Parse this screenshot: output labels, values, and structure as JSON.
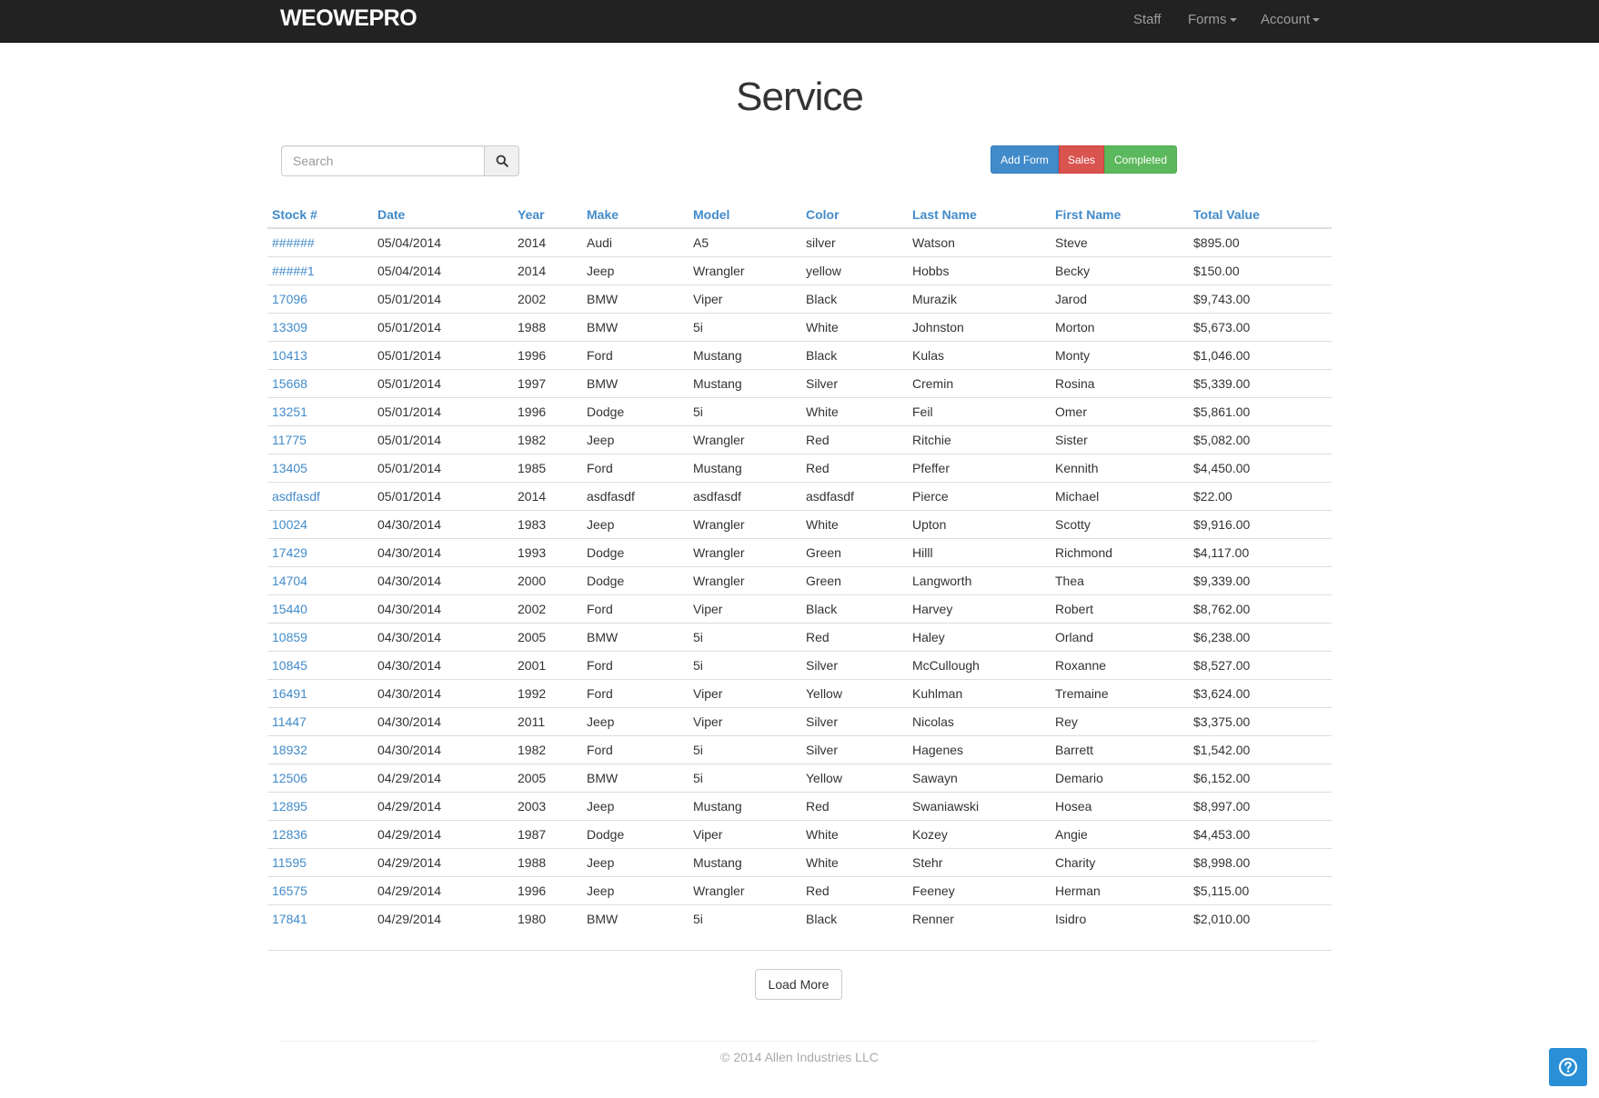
{
  "nav": {
    "brand": "WEOWEPRO",
    "links": [
      {
        "label": "Staff"
      },
      {
        "label": "Forms"
      },
      {
        "label": "Account"
      }
    ]
  },
  "page": {
    "title": "Service"
  },
  "search": {
    "placeholder": "Search",
    "value": ""
  },
  "actions": {
    "add_form": "Add Form",
    "sales": "Sales",
    "completed": "Completed"
  },
  "table": {
    "headers": [
      "Stock #",
      "Date",
      "Year",
      "Make",
      "Model",
      "Color",
      "Last Name",
      "First Name",
      "Total Value"
    ],
    "rows": [
      {
        "stock": "######",
        "date": "05/04/2014",
        "year": "2014",
        "make": "Audi",
        "model": "A5",
        "color": "silver",
        "last": "Watson",
        "first": "Steve",
        "total": "$895.00"
      },
      {
        "stock": "#####1",
        "date": "05/04/2014",
        "year": "2014",
        "make": "Jeep",
        "model": "Wrangler",
        "color": "yellow",
        "last": "Hobbs",
        "first": "Becky",
        "total": "$150.00"
      },
      {
        "stock": "17096",
        "date": "05/01/2014",
        "year": "2002",
        "make": "BMW",
        "model": "Viper",
        "color": "Black",
        "last": "Murazik",
        "first": "Jarod",
        "total": "$9,743.00"
      },
      {
        "stock": "13309",
        "date": "05/01/2014",
        "year": "1988",
        "make": "BMW",
        "model": "5i",
        "color": "White",
        "last": "Johnston",
        "first": "Morton",
        "total": "$5,673.00"
      },
      {
        "stock": "10413",
        "date": "05/01/2014",
        "year": "1996",
        "make": "Ford",
        "model": "Mustang",
        "color": "Black",
        "last": "Kulas",
        "first": "Monty",
        "total": "$1,046.00"
      },
      {
        "stock": "15668",
        "date": "05/01/2014",
        "year": "1997",
        "make": "BMW",
        "model": "Mustang",
        "color": "Silver",
        "last": "Cremin",
        "first": "Rosina",
        "total": "$5,339.00"
      },
      {
        "stock": "13251",
        "date": "05/01/2014",
        "year": "1996",
        "make": "Dodge",
        "model": "5i",
        "color": "White",
        "last": "Feil",
        "first": "Omer",
        "total": "$5,861.00"
      },
      {
        "stock": "11775",
        "date": "05/01/2014",
        "year": "1982",
        "make": "Jeep",
        "model": "Wrangler",
        "color": "Red",
        "last": "Ritchie",
        "first": "Sister",
        "total": "$5,082.00"
      },
      {
        "stock": "13405",
        "date": "05/01/2014",
        "year": "1985",
        "make": "Ford",
        "model": "Mustang",
        "color": "Red",
        "last": "Pfeffer",
        "first": "Kennith",
        "total": "$4,450.00"
      },
      {
        "stock": "asdfasdf",
        "date": "05/01/2014",
        "year": "2014",
        "make": "asdfasdf",
        "model": "asdfasdf",
        "color": "asdfasdf",
        "last": "Pierce",
        "first": "Michael",
        "total": "$22.00"
      },
      {
        "stock": "10024",
        "date": "04/30/2014",
        "year": "1983",
        "make": "Jeep",
        "model": "Wrangler",
        "color": "White",
        "last": "Upton",
        "first": "Scotty",
        "total": "$9,916.00"
      },
      {
        "stock": "17429",
        "date": "04/30/2014",
        "year": "1993",
        "make": "Dodge",
        "model": "Wrangler",
        "color": "Green",
        "last": "Hilll",
        "first": "Richmond",
        "total": "$4,117.00"
      },
      {
        "stock": "14704",
        "date": "04/30/2014",
        "year": "2000",
        "make": "Dodge",
        "model": "Wrangler",
        "color": "Green",
        "last": "Langworth",
        "first": "Thea",
        "total": "$9,339.00"
      },
      {
        "stock": "15440",
        "date": "04/30/2014",
        "year": "2002",
        "make": "Ford",
        "model": "Viper",
        "color": "Black",
        "last": "Harvey",
        "first": "Robert",
        "total": "$8,762.00"
      },
      {
        "stock": "10859",
        "date": "04/30/2014",
        "year": "2005",
        "make": "BMW",
        "model": "5i",
        "color": "Red",
        "last": "Haley",
        "first": "Orland",
        "total": "$6,238.00"
      },
      {
        "stock": "10845",
        "date": "04/30/2014",
        "year": "2001",
        "make": "Ford",
        "model": "5i",
        "color": "Silver",
        "last": "McCullough",
        "first": "Roxanne",
        "total": "$8,527.00"
      },
      {
        "stock": "16491",
        "date": "04/30/2014",
        "year": "1992",
        "make": "Ford",
        "model": "Viper",
        "color": "Yellow",
        "last": "Kuhlman",
        "first": "Tremaine",
        "total": "$3,624.00"
      },
      {
        "stock": "11447",
        "date": "04/30/2014",
        "year": "2011",
        "make": "Jeep",
        "model": "Viper",
        "color": "Silver",
        "last": "Nicolas",
        "first": "Rey",
        "total": "$3,375.00"
      },
      {
        "stock": "18932",
        "date": "04/30/2014",
        "year": "1982",
        "make": "Ford",
        "model": "5i",
        "color": "Silver",
        "last": "Hagenes",
        "first": "Barrett",
        "total": "$1,542.00"
      },
      {
        "stock": "12506",
        "date": "04/29/2014",
        "year": "2005",
        "make": "BMW",
        "model": "5i",
        "color": "Yellow",
        "last": "Sawayn",
        "first": "Demario",
        "total": "$6,152.00"
      },
      {
        "stock": "12895",
        "date": "04/29/2014",
        "year": "2003",
        "make": "Jeep",
        "model": "Mustang",
        "color": "Red",
        "last": "Swaniawski",
        "first": "Hosea",
        "total": "$8,997.00"
      },
      {
        "stock": "12836",
        "date": "04/29/2014",
        "year": "1987",
        "make": "Dodge",
        "model": "Viper",
        "color": "White",
        "last": "Kozey",
        "first": "Angie",
        "total": "$4,453.00"
      },
      {
        "stock": "11595",
        "date": "04/29/2014",
        "year": "1988",
        "make": "Jeep",
        "model": "Mustang",
        "color": "White",
        "last": "Stehr",
        "first": "Charity",
        "total": "$8,998.00"
      },
      {
        "stock": "16575",
        "date": "04/29/2014",
        "year": "1996",
        "make": "Jeep",
        "model": "Wrangler",
        "color": "Red",
        "last": "Feeney",
        "first": "Herman",
        "total": "$5,115.00"
      },
      {
        "stock": "17841",
        "date": "04/29/2014",
        "year": "1980",
        "make": "BMW",
        "model": "5i",
        "color": "Black",
        "last": "Renner",
        "first": "Isidro",
        "total": "$2,010.00"
      }
    ]
  },
  "load_more": "Load More",
  "footer": {
    "copyright": "© 2014 Allen Industries LLC"
  },
  "icons": {
    "search": "search-icon",
    "help": "question-circle-icon",
    "caret": "caret-down-icon"
  },
  "colors": {
    "navbar": "#222222",
    "link": "#428bca",
    "primary": "#428bca",
    "danger": "#d9534f",
    "success": "#5cb85c",
    "help": "#2a8fd6"
  }
}
